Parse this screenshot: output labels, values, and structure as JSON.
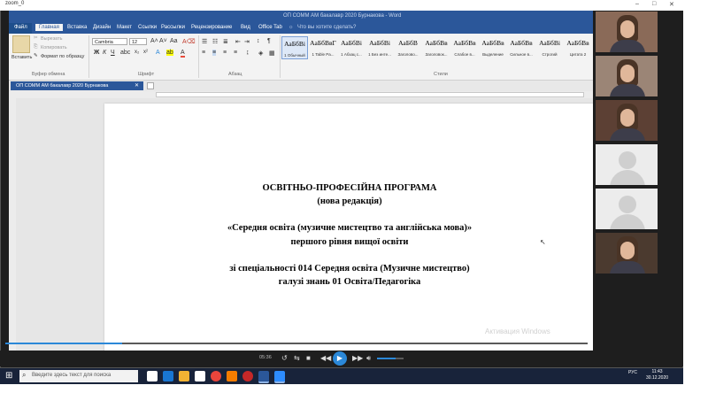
{
  "zoom": {
    "title": "zoom_0",
    "minimize": "–",
    "maximize": "□",
    "close": "✕"
  },
  "word": {
    "title": "ОП СОММ АМ бакалавр 2020 Бурнакова - Word",
    "tabs": [
      "Файл",
      "Главная",
      "Вставка",
      "Дизайн",
      "Макет",
      "Ссылки",
      "Рассылки",
      "Рецензирование",
      "Вид",
      "Office Tab"
    ],
    "tell_me": "Что вы хотите сделать?",
    "clipboard": {
      "paste": "Вставить",
      "cut": "Вырезать",
      "copy": "Копировать",
      "format_painter": "Формат по образцу",
      "group": "Буфер обмена"
    },
    "font": {
      "name": "Cambria",
      "size": "12",
      "group": "Шрифт"
    },
    "paragraph_group": "Абзац",
    "styles_group": "Стили",
    "styles": [
      {
        "preview": "АаБбВі",
        "name": "1 Обычный",
        "selected": true
      },
      {
        "preview": "АаБбВвГ",
        "name": "1 Table Pa...",
        "selected": false
      },
      {
        "preview": "АаБбВі",
        "name": "1 Абзац с...",
        "selected": false
      },
      {
        "preview": "АаБбВі",
        "name": "1 Без инте...",
        "selected": false
      },
      {
        "preview": "АаБбВ",
        "name": "Заголово...",
        "selected": false
      },
      {
        "preview": "АаБбВв",
        "name": "Заголовок...",
        "selected": false
      },
      {
        "preview": "АаБбВв",
        "name": "Слабое в...",
        "selected": false
      },
      {
        "preview": "АаБбВв",
        "name": "Выделение",
        "selected": false
      },
      {
        "preview": "АаБбВв",
        "name": "Сильное в...",
        "selected": false
      },
      {
        "preview": "АаБбВі",
        "name": "Строгий",
        "selected": false
      },
      {
        "preview": "АаБбВв",
        "name": "Цитата 2",
        "selected": false
      }
    ],
    "doc_tab": "ОП СОММ АМ бакалавр 2020 Бурнакова",
    "document_lines": [
      "ОСВІТНЬО-ПРОФЕСІЙНА ПРОГРАМА",
      "(нова редакція)",
      "«Середня освіта (музичне мистецтво та англійська мова)»",
      "першого рівня вищої освіти",
      "зі спеціальності 014 Середня освіта (Музичне мистецтво)",
      "галузі знань 01 Освіта/Педагогіка"
    ],
    "watermark": "Активация Windows"
  },
  "player": {
    "time": "05:36",
    "progress": 0.2,
    "volume": 0.7
  },
  "participants": [
    "camera",
    "camera",
    "camera",
    "no-video",
    "no-video",
    "camera"
  ],
  "taskbar": {
    "search_placeholder": "Введите здесь текст для поиска",
    "lang": "РУС",
    "time": "11:43",
    "date": "30.12.2020"
  },
  "colors": {
    "word_blue": "#2b579a",
    "accent": "#2b88d8",
    "taskbar": "#18233a"
  }
}
